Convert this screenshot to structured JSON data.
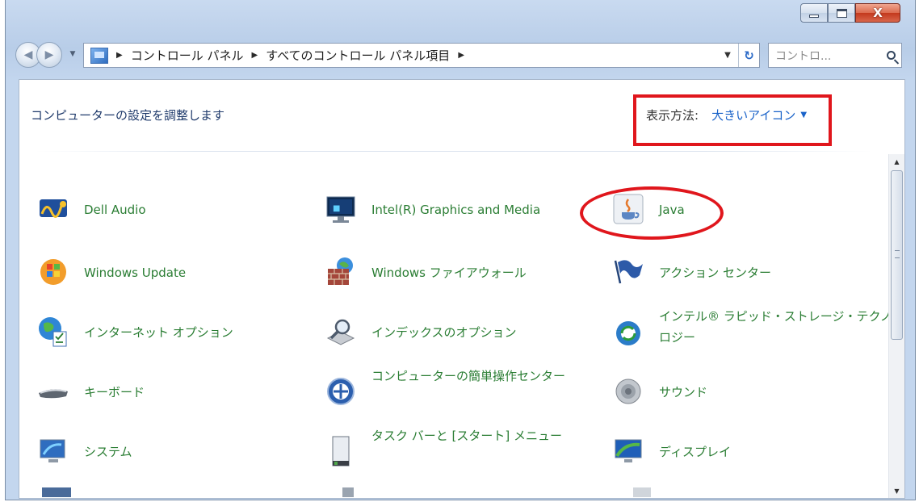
{
  "window": {
    "controls": {
      "minimize": "minimize",
      "maximize": "maximize",
      "close": "X"
    }
  },
  "navigation": {
    "breadcrumbs": [
      "コントロール パネル",
      "すべてのコントロール パネル項目"
    ],
    "search_placeholder": "コントロ..."
  },
  "content": {
    "heading": "コンピューターの設定を調整します",
    "view_by_label": "表示方法:",
    "view_by_value": "大きいアイコン"
  },
  "items": [
    {
      "label": "Dell Audio",
      "icon": "dell-audio-icon"
    },
    {
      "label": "Intel(R) Graphics and Media",
      "icon": "intel-graphics-icon"
    },
    {
      "label": "Java",
      "icon": "java-icon"
    },
    {
      "label": "Windows Update",
      "icon": "windows-update-icon"
    },
    {
      "label": "Windows ファイアウォール",
      "icon": "firewall-icon"
    },
    {
      "label": "アクション センター",
      "icon": "action-center-flag-icon"
    },
    {
      "label": "インターネット オプション",
      "icon": "internet-options-icon"
    },
    {
      "label": "インデックスのオプション",
      "icon": "indexing-options-icon"
    },
    {
      "label": "インテル® ラピッド・ストレージ・テクノロジー",
      "icon": "intel-rst-icon"
    },
    {
      "label": "キーボード",
      "icon": "keyboard-icon"
    },
    {
      "label": "コンピューターの簡単操作センター",
      "icon": "ease-of-access-icon"
    },
    {
      "label": "サウンド",
      "icon": "sound-icon"
    },
    {
      "label": "システム",
      "icon": "system-icon"
    },
    {
      "label": "タスク バーと [スタート] メニュー",
      "icon": "taskbar-icon"
    },
    {
      "label": "ディスプレイ",
      "icon": "display-icon"
    }
  ],
  "annotations": {
    "color": "#e0161c"
  }
}
